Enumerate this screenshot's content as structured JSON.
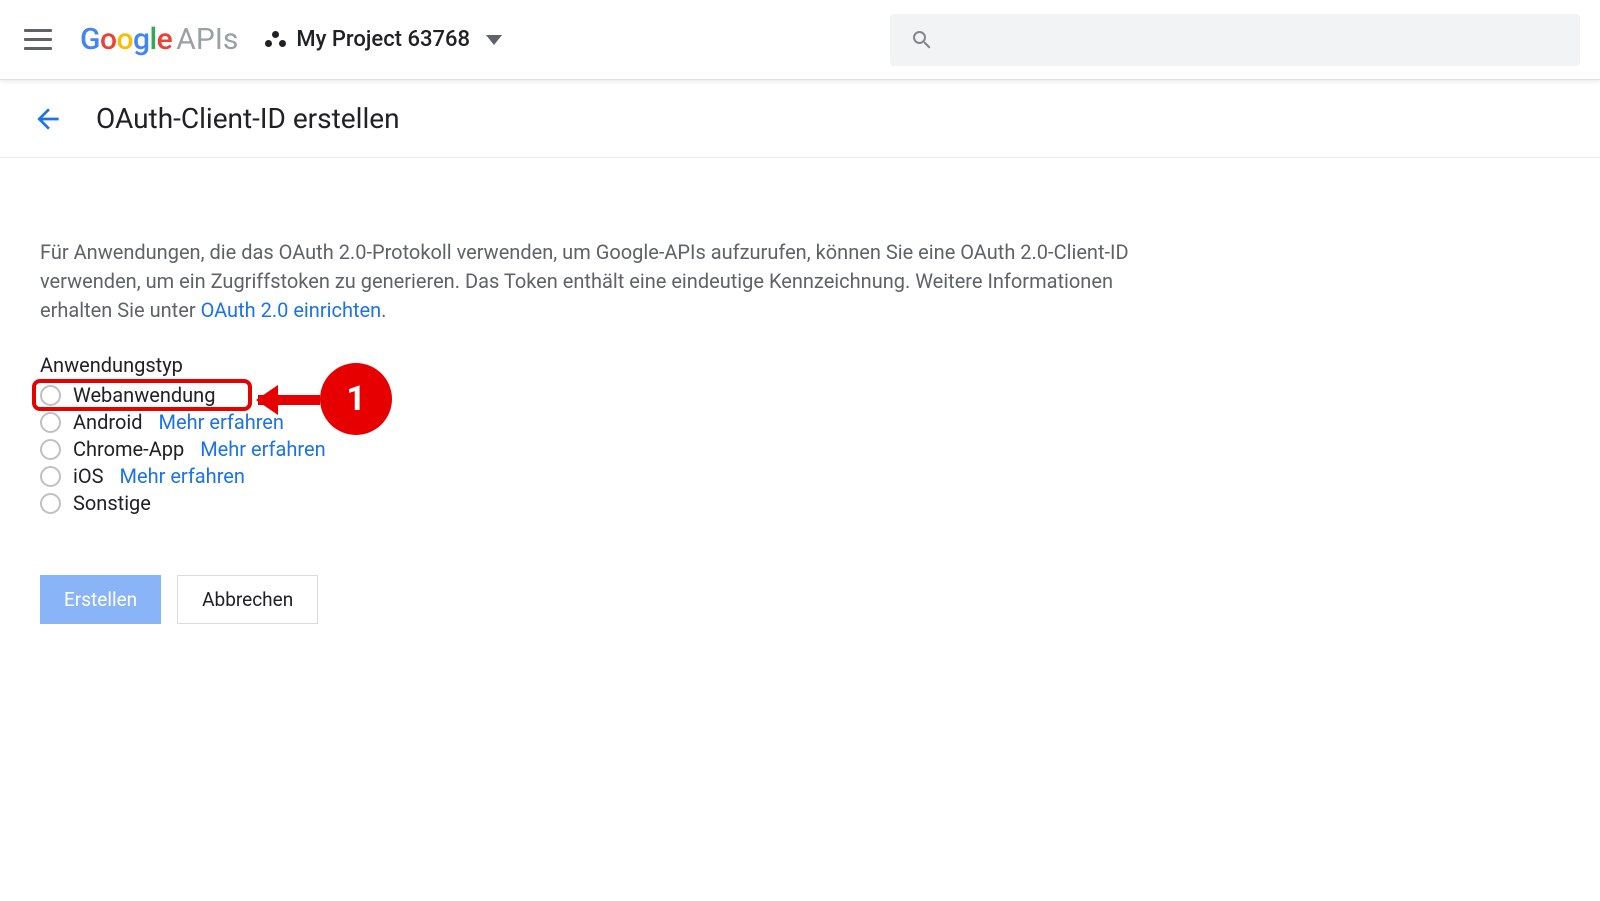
{
  "header": {
    "logo_suffix": "APIs",
    "project_name": "My Project 63768"
  },
  "titlebar": {
    "page_title": "OAuth-Client-ID erstellen"
  },
  "main": {
    "description_pre": "Für Anwendungen, die das OAuth 2.0-Protokoll verwenden, um Google-APIs aufzurufen, können Sie eine OAuth 2.0-Client-ID verwenden, um ein Zugriffstoken zu generieren. Das Token enthält eine eindeutige Kennzeichnung. Weitere Informationen erhalten Sie unter ",
    "description_link": "OAuth 2.0 einrichten",
    "description_post": ".",
    "field_label": "Anwendungstyp",
    "options": [
      {
        "label": "Webanwendung",
        "link": ""
      },
      {
        "label": "Android",
        "link": "Mehr erfahren"
      },
      {
        "label": "Chrome-App",
        "link": "Mehr erfahren"
      },
      {
        "label": "iOS",
        "link": "Mehr erfahren"
      },
      {
        "label": "Sonstige",
        "link": ""
      }
    ],
    "callout_number": "1",
    "create_label": "Erstellen",
    "cancel_label": "Abbrechen"
  }
}
